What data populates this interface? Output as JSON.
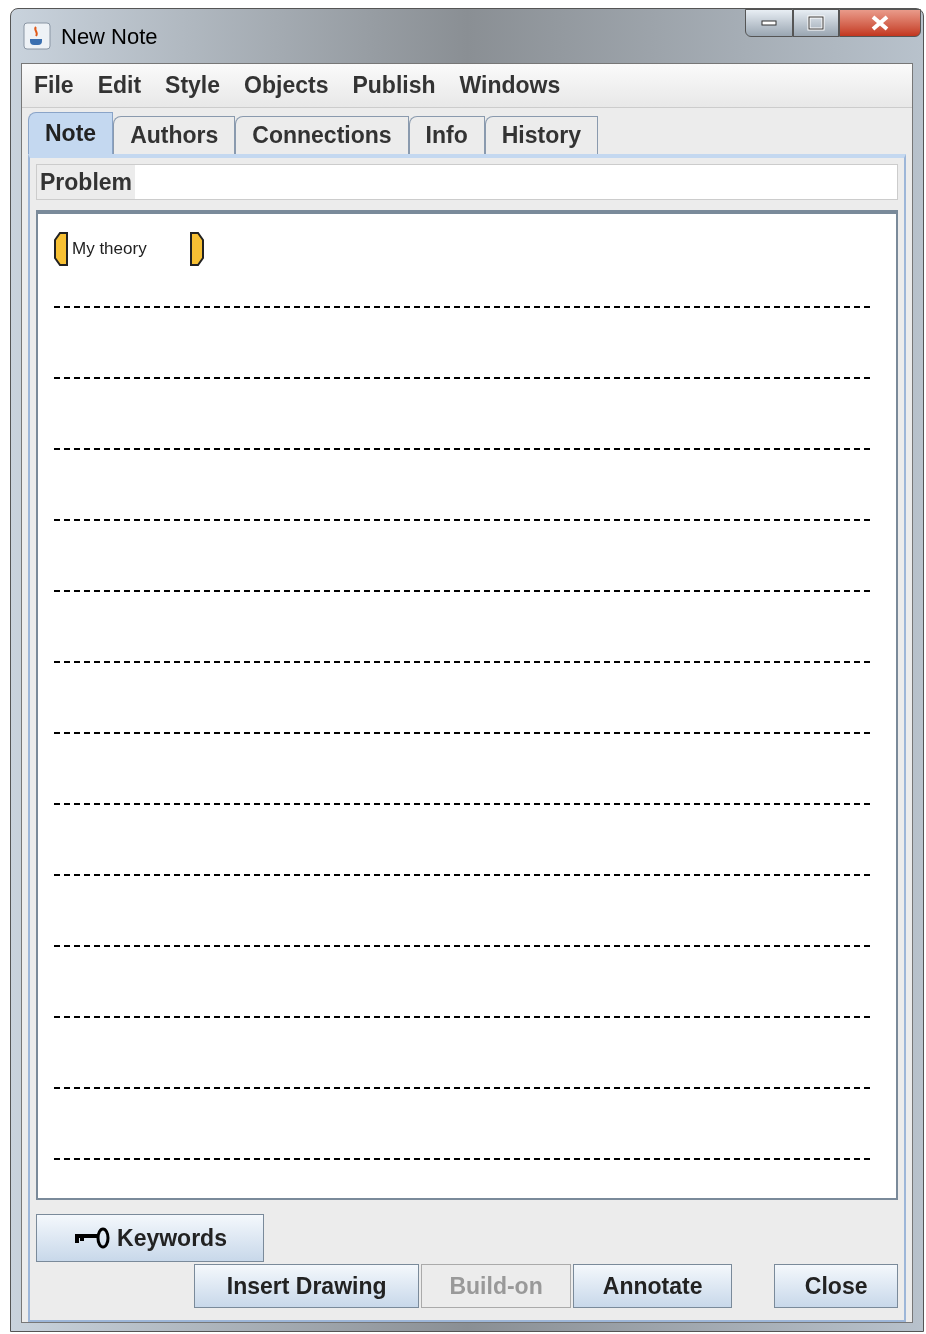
{
  "window": {
    "title": "New Note"
  },
  "menu": [
    {
      "label": "File"
    },
    {
      "label": "Edit"
    },
    {
      "label": "Style"
    },
    {
      "label": "Objects"
    },
    {
      "label": "Publish"
    },
    {
      "label": "Windows"
    }
  ],
  "tabs": [
    {
      "label": "Note",
      "selected": true
    },
    {
      "label": "Authors",
      "selected": false
    },
    {
      "label": "Connections",
      "selected": false
    },
    {
      "label": "Info",
      "selected": false
    },
    {
      "label": "History",
      "selected": false
    }
  ],
  "problem": {
    "label": "Problem"
  },
  "scaffold": {
    "label": "My theory"
  },
  "keywords_button": "Keywords",
  "buttons": [
    {
      "label": "Insert Drawing",
      "disabled": false
    },
    {
      "label": "Build-on",
      "disabled": true
    },
    {
      "label": "Annotate",
      "disabled": false
    },
    {
      "label": "Close",
      "disabled": false
    }
  ]
}
